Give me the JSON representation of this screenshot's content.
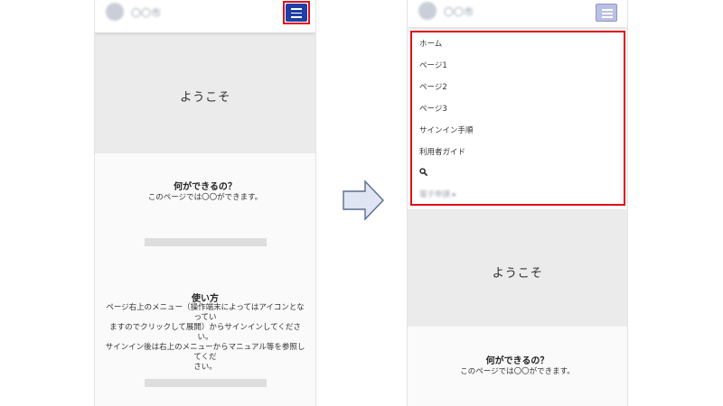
{
  "left_screen": {
    "logo_text": "〇〇市",
    "hero_text": "ようこそ",
    "section1": {
      "title": "何ができるの？",
      "body": "このページでは〇〇ができます。"
    },
    "section2": {
      "title": "使い方",
      "body_lines": [
        "ページ右上のメニュー（操作端末によってはアイコンとなってい",
        "ますのでクリックして展開）からサインインしてください。",
        "サインイン後は右上のメニューからマニュアル等を参照してくだ",
        "さい。"
      ]
    }
  },
  "right_screen": {
    "logo_text": "〇〇市",
    "menu_items": [
      "ホーム",
      "ページ1",
      "ページ2",
      "ページ3",
      "サインイン手順",
      "利用者ガイド"
    ],
    "menu_blurred": "電子申請 ▸",
    "hero_text": "ようこそ",
    "section1": {
      "title": "何ができるの？",
      "body": "このページでは〇〇ができます。"
    }
  },
  "icons": {
    "menu": "hamburger-menu-icon",
    "search": "search-icon",
    "arrow": "right-arrow-icon"
  },
  "colors": {
    "highlight": "#e0101a",
    "menu_button_active": "#1f3fa6",
    "menu_button_pressed": "#b9c0e6",
    "arrow_fill": "#dfe5f2",
    "arrow_stroke": "#5b6d8e"
  }
}
